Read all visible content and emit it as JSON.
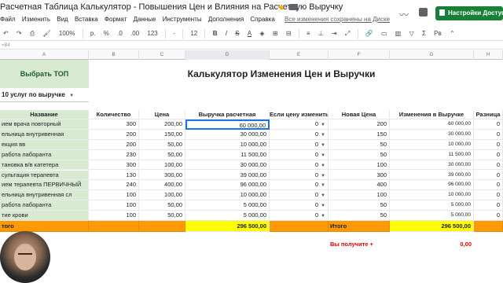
{
  "window": {
    "doc_title": "Расчетная Таблица Калькулятор - Повышения Цен и Влияния на Расчетную Выручку",
    "menu": [
      "Файл",
      "Изменить",
      "Вид",
      "Вставка",
      "Формат",
      "Данные",
      "Инструменты",
      "Дополнения",
      "Справка"
    ],
    "saved_status": "Все изменения сохранены на Диске",
    "share_label": "Настройки Доступа"
  },
  "toolbar": {
    "zoom": "100%",
    "currency": "р.",
    "percent": "%",
    "decimals_less": ".0",
    "decimals_more": ".00",
    "format_more": "123",
    "font": "-",
    "font_size": "12",
    "bold": "B",
    "italic": "I",
    "strike": "S",
    "text_color": "A",
    "functions": "Σ",
    "input_tools": "Рв"
  },
  "formula_bar": "=B4",
  "columns": [
    "A",
    "B",
    "C",
    "D",
    "E",
    "F",
    "G",
    "H"
  ],
  "sheet": {
    "top_label": "Выбрать ТОП",
    "title": "Калькулятор Изменения Цен и Выручки",
    "top_select": "10 услуг по выручке",
    "headers": {
      "name": "Название",
      "qty": "Количество",
      "price": "Цена",
      "revenue": "Выручка расчетная",
      "if_change": "Если цену изменить",
      "new_price": "Новая Цена",
      "rev_change": "Изменения в Выручке",
      "diff": "Разница"
    },
    "rows": [
      {
        "name": "ием врача повторный",
        "qty": "300",
        "price": "200,00",
        "revenue": "60 000,00",
        "change": "0",
        "new_price": "200",
        "rev_change": "60 000,00",
        "diff": "0"
      },
      {
        "name": "ельница внутривенная",
        "qty": "200",
        "price": "150,00",
        "revenue": "30 000,00",
        "change": "0",
        "new_price": "150",
        "rev_change": "30 000,00",
        "diff": "0"
      },
      {
        "name": "екция вв",
        "qty": "200",
        "price": "50,00",
        "revenue": "10 000,00",
        "change": "0",
        "new_price": "50",
        "rev_change": "10 000,00",
        "diff": "0"
      },
      {
        "name": "работа лаборанта",
        "qty": "230",
        "price": "50,00",
        "revenue": "11 500,00",
        "change": "0",
        "new_price": "50",
        "rev_change": "11 500,00",
        "diff": "0"
      },
      {
        "name": "тановка в/в катетера",
        "qty": "300",
        "price": "100,00",
        "revenue": "30 000,00",
        "change": "0",
        "new_price": "100",
        "rev_change": "30 000,00",
        "diff": "0"
      },
      {
        "name": "сультация терапевта",
        "qty": "130",
        "price": "300,00",
        "revenue": "39 000,00",
        "change": "0",
        "new_price": "300",
        "rev_change": "39 000,00",
        "diff": "0"
      },
      {
        "name": "ием терапевта ПЕРВИЧНЫЙ",
        "qty": "240",
        "price": "400,00",
        "revenue": "96 000,00",
        "change": "0",
        "new_price": "400",
        "rev_change": "96 000,00",
        "diff": "0"
      },
      {
        "name": "ельница внутривенная сл",
        "qty": "100",
        "price": "100,00",
        "revenue": "10 000,00",
        "change": "0",
        "new_price": "100",
        "rev_change": "10 000,00",
        "diff": "0"
      },
      {
        "name": "работа лаборанта",
        "qty": "100",
        "price": "50,00",
        "revenue": "5 000,00",
        "change": "0",
        "new_price": "50",
        "rev_change": "5 000,00",
        "diff": "0"
      },
      {
        "name": "тие крови",
        "qty": "100",
        "price": "50,00",
        "revenue": "5 000,00",
        "change": "0",
        "new_price": "50",
        "rev_change": "5 000,00",
        "diff": "0"
      }
    ],
    "total_label": "того",
    "total_revenue": "296 500,00",
    "total_label_2": "Итого",
    "total_rev_change": "296 500,00",
    "you_get_label": "Вы получите +",
    "you_get_value": "0,00"
  },
  "colors": {
    "header_green": "#d9ead3",
    "total_orange": "#ff9900",
    "total_yellow": "#ffff00",
    "share_green": "#188038",
    "red_text": "#e00000"
  }
}
